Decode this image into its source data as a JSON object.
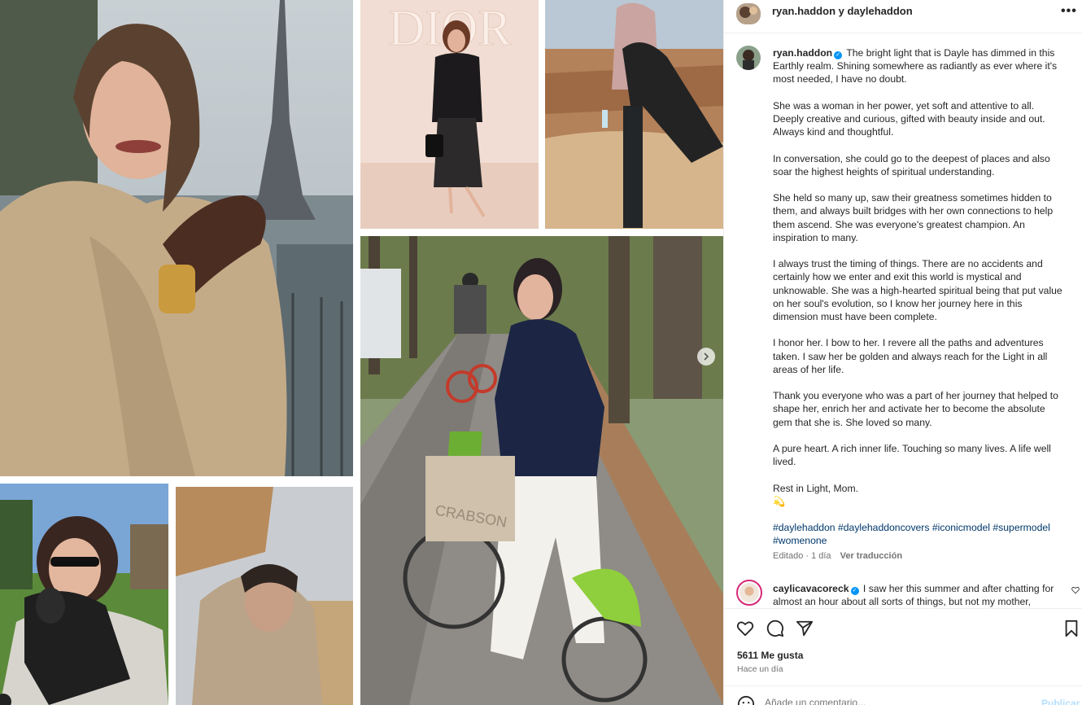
{
  "header": {
    "title": "ryan.haddon y daylehaddon",
    "more_label": "•••"
  },
  "caption": {
    "username": "ryan.haddon",
    "paragraphs": [
      "The bright light that is Dayle has dimmed in this Earthly realm. Shining somewhere as radiantly as ever where it's most needed, I have no doubt.",
      "She was a woman in her power, yet soft and attentive to all. Deeply creative and curious, gifted with beauty inside and out. Always kind and thoughtful.",
      "In conversation, she could go to the deepest of places and also soar the highest heights of spiritual understanding.",
      "She held so many up, saw their greatness sometimes hidden to them, and always built bridges with her own connections to help them ascend. She was everyone's greatest champion. An inspiration to many.",
      "I always trust the timing of things. There are no accidents and certainly how we enter and exit this world is mystical and unknowable. She was a high-hearted spiritual being that put value on her soul's evolution, so I know her journey here in this dimension must have been complete.",
      "I honor her. I bow to her. I revere all the paths and adventures taken. I saw her be golden and always reach for the Light in all areas of her life.",
      "Thank you everyone who was a part of her journey that helped to shape her, enrich her and activate her to become the absolute gem that she is. She loved so many.",
      "A pure heart. A rich inner life. Touching so many lives. A life well lived.",
      "Rest in Light, Mom.",
      "💫"
    ],
    "hashtags": [
      "#daylehaddon",
      "#daylehaddoncovers",
      "#iconicmodel",
      "#supermodel",
      "#womenone"
    ],
    "edited": "Editado · 1 día",
    "translate_label": "Ver traducción"
  },
  "comment": {
    "username": "caylicavacoreck",
    "text": "I saw her this summer and after chatting for almost an hour about all sorts of things, but not my mother,"
  },
  "stats": {
    "likes": "5611 Me gusta",
    "time": "Hace un día"
  },
  "add_comment": {
    "placeholder": "Añade un comentario...",
    "publish_label": "Publicar"
  },
  "media": {
    "photo_captions": [
      "DIOR",
      "CRABSON"
    ]
  },
  "colors": {
    "link": "#00376b",
    "verified": "#0095f6",
    "muted": "#737373",
    "bike_green": "#8fce3c"
  }
}
